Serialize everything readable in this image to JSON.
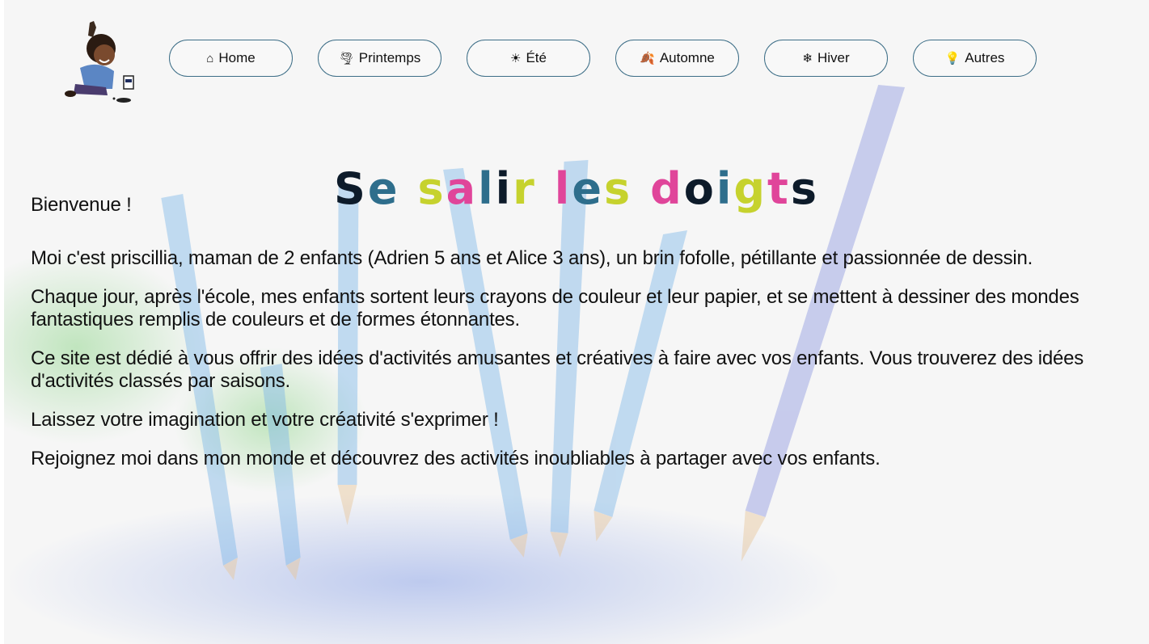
{
  "nav": [
    {
      "icon": "⌂",
      "icon_name": "home-icon",
      "label": "Home"
    },
    {
      "icon": "🌪",
      "icon_name": "flower-icon",
      "label": "Printemps"
    },
    {
      "icon": "☀",
      "icon_name": "sun-icon",
      "label": "Été"
    },
    {
      "icon": "🍂",
      "icon_name": "leaf-icon",
      "label": "Automne"
    },
    {
      "icon": "❄",
      "icon_name": "snowflake-icon",
      "label": "Hiver"
    },
    {
      "icon": "💡",
      "icon_name": "lightbulb-icon",
      "label": "Autres"
    }
  ],
  "title": {
    "text": "Se salir les doigts",
    "letter_colors": [
      "#0d1b2a",
      "#2e6e8c",
      "#c6d22e",
      "#e0459a",
      "#2e6e8c",
      "#0d1b2a",
      "#c6d22e",
      "#e0459a",
      "#2e6e8c",
      "#c6d22e",
      "#e0459a",
      "#0d1b2a",
      "#2e6e8c",
      "#c6d22e",
      "#e0459a"
    ]
  },
  "content": {
    "greeting": "Bienvenue !",
    "paragraphs": [
      "Moi c'est priscillia, maman de 2 enfants (Adrien 5 ans et Alice 3 ans), un brin fofolle, pétillante et passionnée de dessin.",
      "Chaque jour, après l'école, mes enfants sortent leurs crayons de couleur et leur papier, et se mettent à dessiner des mondes fantastiques remplis de couleurs et de formes étonnantes.",
      "Ce site est dédié à vous offrir des idées d'activités amusantes et créatives à faire avec vos enfants. Vous trouverez des idées d'activités classés par saisons.",
      "Laissez votre imagination et votre créativité s'exprimer !",
      "Rejoignez moi dans mon monde et découvrez des activités inoubliables à partager avec vos enfants."
    ]
  },
  "colors": {
    "nav_border": "#3d6e87",
    "dark_navy": "#0d1b2a",
    "teal": "#2e6e8c",
    "lime": "#c6d22e",
    "pink": "#e0459a"
  }
}
